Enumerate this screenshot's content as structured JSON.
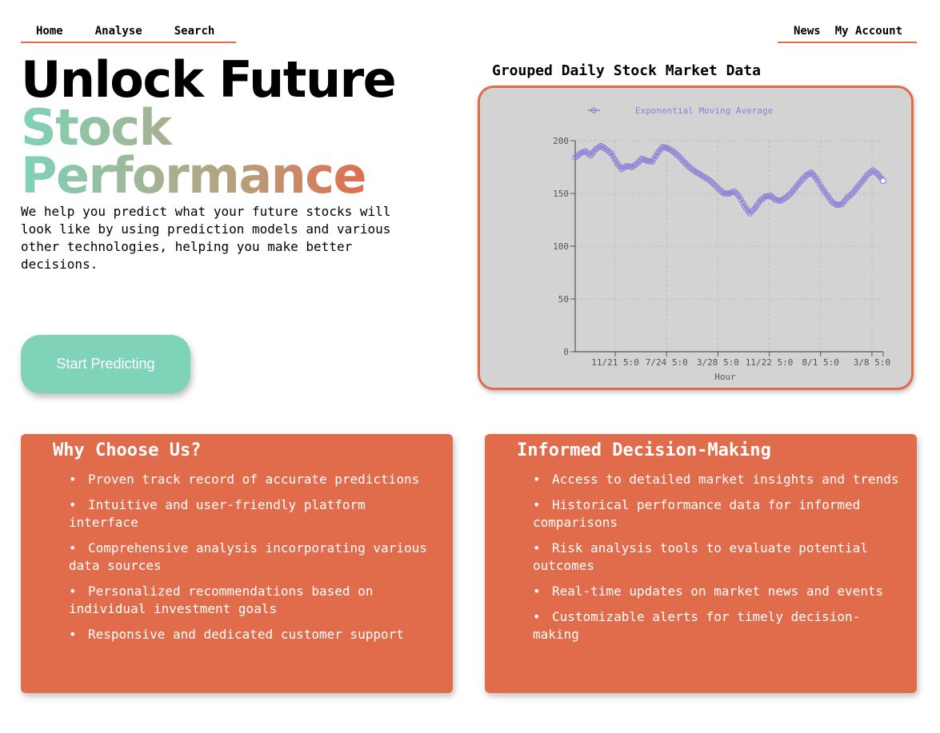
{
  "nav": {
    "left": [
      "Home",
      "Analyse",
      "Search"
    ],
    "right": [
      "News",
      "My Account"
    ]
  },
  "hero": {
    "line1": "Unlock Future",
    "line2": "Stock",
    "line3": "Performance",
    "description": "We help you predict what your future stocks will look like by using prediction models and various other technologies, helping you make better decisions.",
    "cta_label": "Start Predicting"
  },
  "chart_title": "Grouped Daily Stock Market Data",
  "chart_data": {
    "type": "line",
    "title": "Grouped Daily Stock Market Data",
    "legend": {
      "position": "top",
      "entries": [
        "Exponential Moving Average"
      ]
    },
    "xlabel": "Hour",
    "ylabel": "",
    "ylim": [
      0,
      200
    ],
    "yticks": [
      0,
      50,
      100,
      150,
      200
    ],
    "xticks": [
      "11/21 5:0",
      "7/24 5:0",
      "3/28 5:0",
      "11/22 5:0",
      "8/1 5:0",
      "3/8 5:0"
    ],
    "grid": true,
    "colors": {
      "series": "#8d80d6",
      "axis": "#555555",
      "background": "#d3d3d3"
    },
    "series": [
      {
        "name": "Exponential Moving Average",
        "x": [
          0,
          1,
          2,
          3,
          4,
          5,
          6,
          7,
          8,
          9,
          10,
          11,
          12,
          13,
          14,
          15,
          16,
          17,
          18,
          19,
          20,
          21,
          22,
          23,
          24,
          25,
          26,
          27,
          28,
          29,
          30,
          31,
          32,
          33,
          34,
          35,
          36,
          37,
          38,
          39,
          40,
          41,
          42,
          43,
          44,
          45,
          46,
          47,
          48,
          49,
          50,
          51,
          52,
          53,
          54,
          55,
          56,
          57,
          58,
          59,
          60
        ],
        "values": [
          184,
          188,
          190,
          186,
          192,
          195,
          192,
          188,
          180,
          173,
          176,
          175,
          178,
          183,
          181,
          180,
          188,
          194,
          193,
          190,
          186,
          181,
          176,
          172,
          169,
          166,
          163,
          159,
          154,
          150,
          150,
          152,
          147,
          138,
          131,
          136,
          143,
          147,
          148,
          144,
          143,
          146,
          150,
          156,
          162,
          167,
          170,
          164,
          156,
          149,
          142,
          139,
          140,
          146,
          150,
          156,
          162,
          168,
          172,
          168,
          162
        ]
      }
    ]
  },
  "cards": [
    {
      "title": "Why Choose Us?",
      "items": [
        "Proven track record of accurate predictions",
        "Intuitive and user-friendly platform interface",
        "Comprehensive analysis incorporating various data sources",
        "Personalized recommendations based on individual investment goals",
        "Responsive and dedicated customer support"
      ]
    },
    {
      "title": "Informed Decision-Making",
      "items": [
        "Access to detailed market insights and trends",
        "Historical performance data for informed comparisons",
        "Risk analysis tools to evaluate potential outcomes",
        "Real-time updates on market news and events",
        "Customizable alerts for timely decision-making"
      ]
    }
  ]
}
